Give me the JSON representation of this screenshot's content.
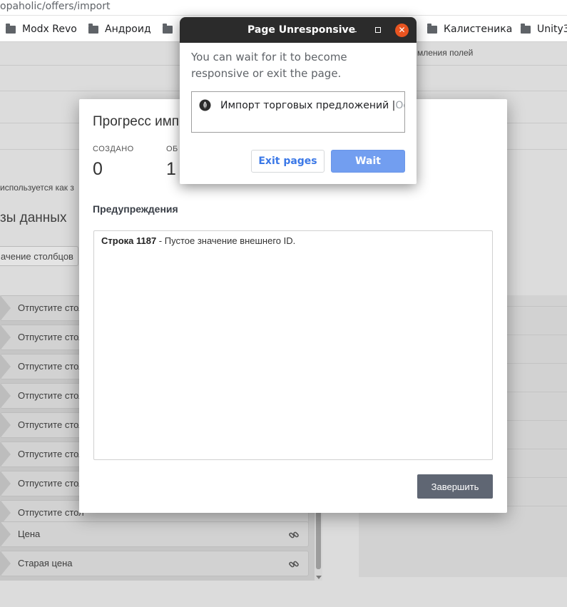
{
  "browser": {
    "url": "opaholic/offers/import",
    "bookmarks": [
      {
        "label": "Modx Revo"
      },
      {
        "label": "Андроид"
      },
      {
        "label": ""
      },
      {
        "label": "Калистеника"
      },
      {
        "label": "Unity3"
      }
    ]
  },
  "background": {
    "top_right_hint": "мления полей",
    "side_text": "используется как з",
    "section_heading": "зы данных",
    "columns_button": "ачение столбцов",
    "rows": [
      {
        "label": "Отпустите стол"
      },
      {
        "label": "Отпустите стол"
      },
      {
        "label": "Отпустите стол"
      },
      {
        "label": "Отпустите стол"
      },
      {
        "label": "Отпустите стол"
      },
      {
        "label": "Отпустите стол"
      },
      {
        "label": "Отпустите стол"
      },
      {
        "label": "Отпустите стол"
      },
      {
        "label": "Цена"
      },
      {
        "label": "Старая цена"
      }
    ]
  },
  "modal": {
    "title": "Прогресс импо",
    "stats": [
      {
        "label": "СОЗДАНО",
        "value": "0"
      },
      {
        "label": "ОБ",
        "value": "1"
      }
    ],
    "warnings_title": "Предупреждения",
    "warnings": [
      {
        "row": "Строка 1187",
        "text": " - Пустое значение внешнего ID."
      }
    ],
    "finish_label": "Завершить"
  },
  "dialog": {
    "title": "Page Unresponsive",
    "message": "You can wait for it to become responsive or exit the page.",
    "page_title": "Импорт торговых предложений | ",
    "page_title_faded": "Оо",
    "exit_label": "Exit pages",
    "wait_label": "Wait",
    "close_glyph": "✕"
  }
}
